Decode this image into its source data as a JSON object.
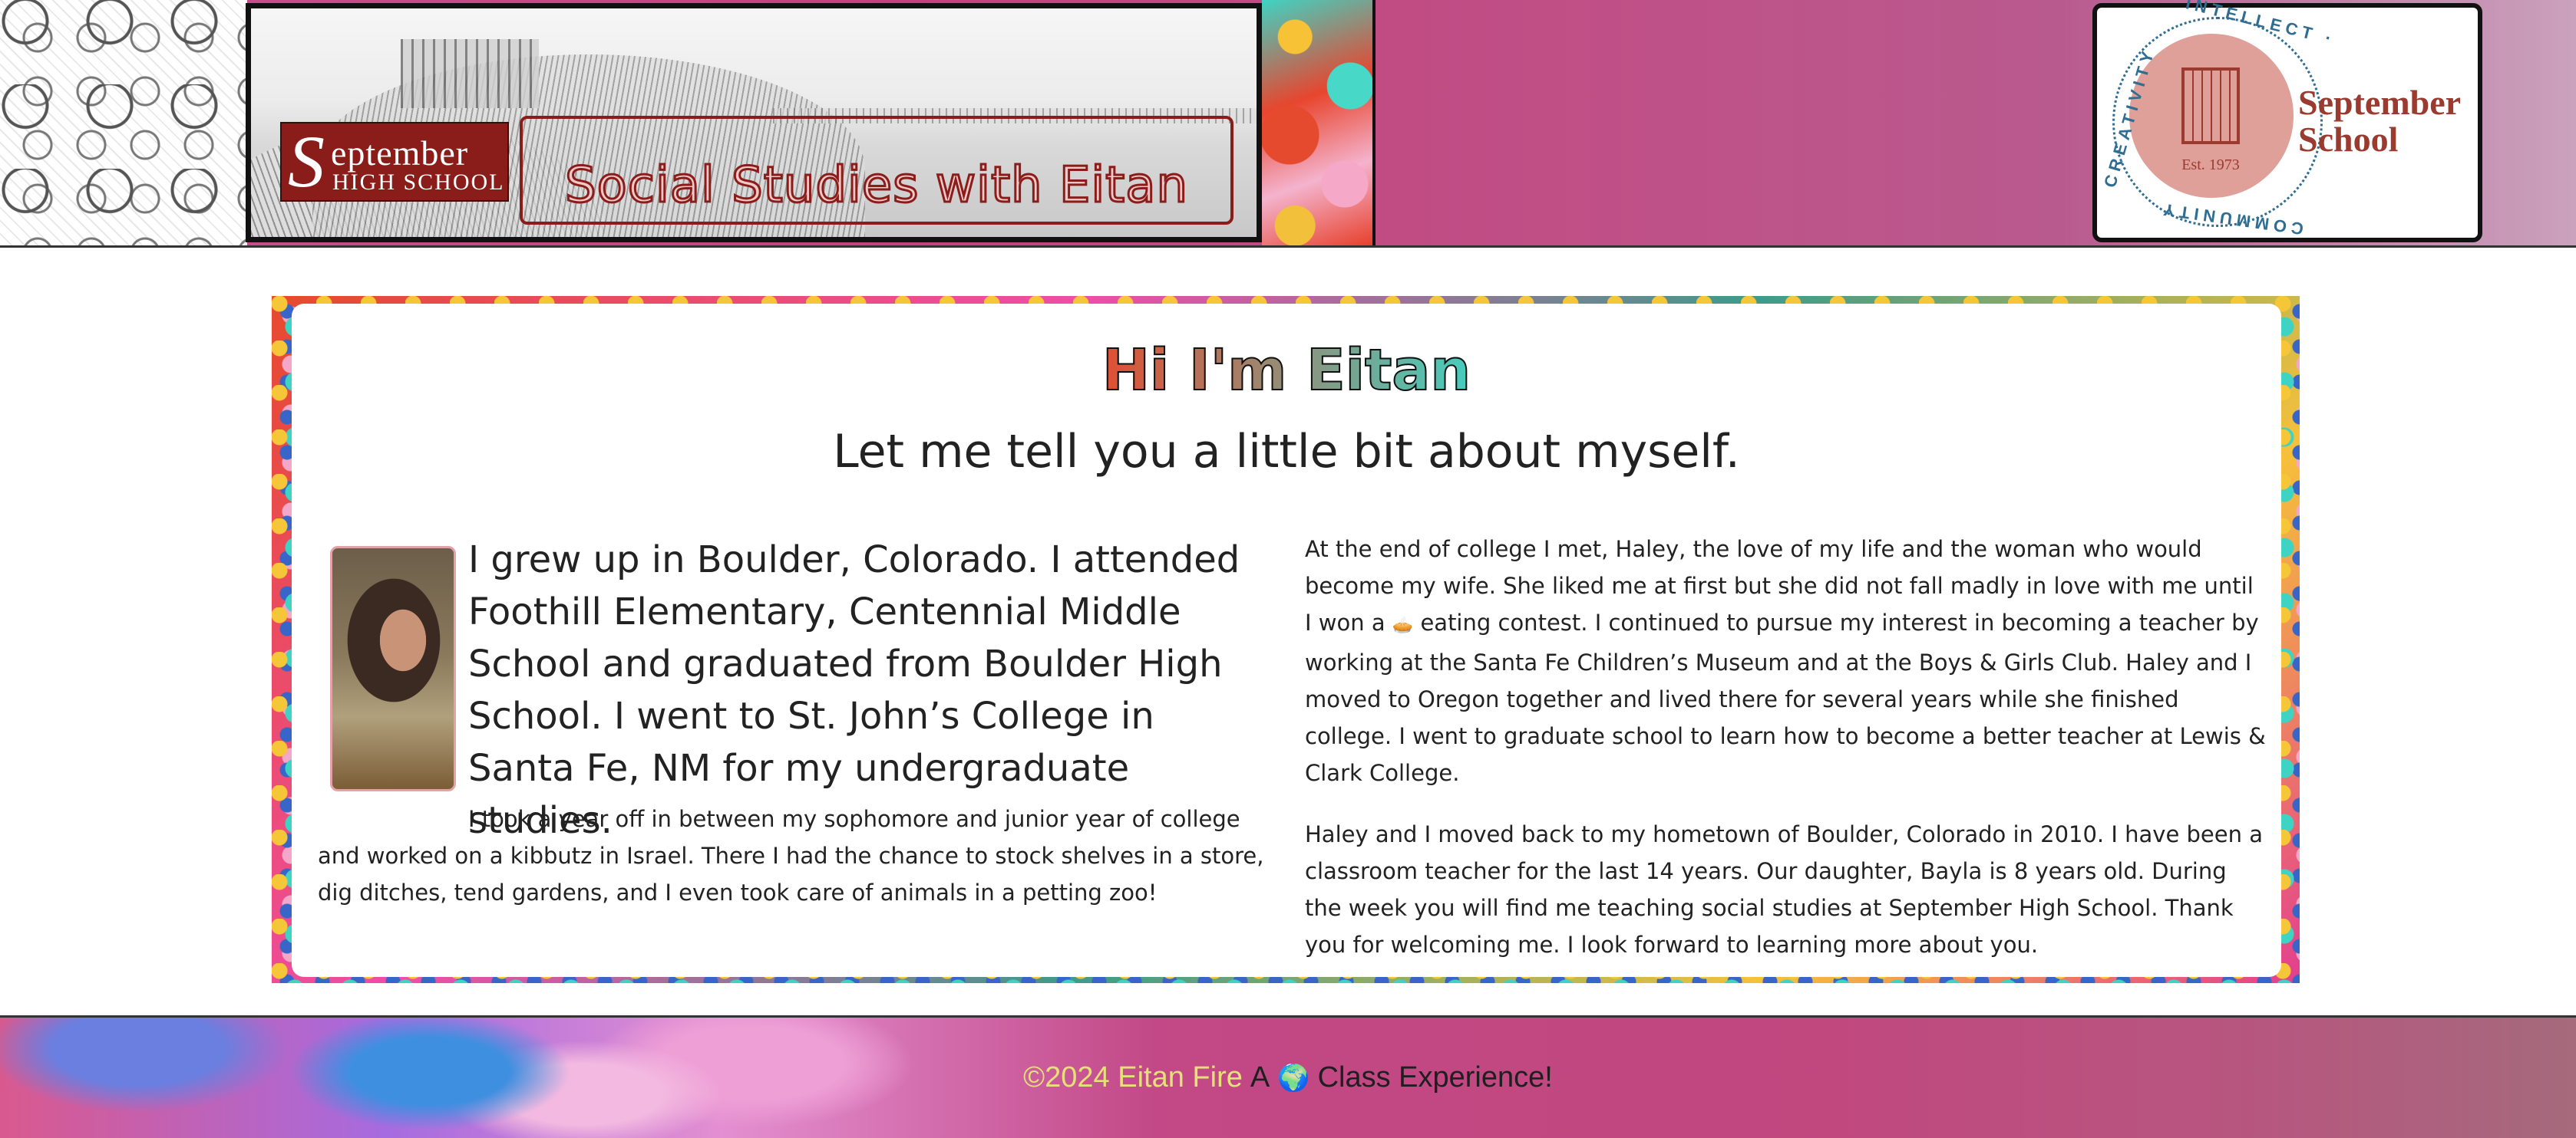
{
  "header": {
    "school_logo": {
      "initial": "S",
      "line1": "eptember",
      "line2": "HIGH SCHOOL"
    },
    "banner_title": "Social Studies with Eitan",
    "seal": {
      "top_text": "· INTELLECT ·",
      "left_text": "CREATIVITY",
      "bottom_text": "COMMUNITY",
      "established": "Est. 1973",
      "name_line1": "September",
      "name_line2": "School"
    }
  },
  "main": {
    "greeting": "Hi I'm Eitan",
    "subheading": "Let me tell you a little bit about myself.",
    "lead_paragraph": "I grew up in Boulder, Colorado. I attended Foothill Elementary, Centennial Middle School and graduated from Boulder High School. I went to St. John’s College in Santa Fe, NM for my undergraduate studies.",
    "kibbutz_paragraph": "I took a year off in between my sophomore and junior year of college and worked on a kibbutz in Israel. There I had the chance to stock shelves in a store, dig ditches, tend gardens, and I even took care of animals in a petting zoo!",
    "college_paragraph_before": "At the end of college I met, Haley, the love of my life and the woman who would become my wife. She liked me at first but she did not fall madly in love with me until I won a",
    "college_paragraph_emoji": "🥧",
    "college_paragraph_after": "eating contest. I continued to pursue my interest in becoming a teacher by working at the Santa Fe Children’s Museum and at the Boys & Girls Club. Haley and I moved to Oregon together and lived there for several years while she finished college. I went to graduate school to learn how to become a better teacher at Lewis & Clark College.",
    "boulder_paragraph": "Haley and I moved back to my hometown of Boulder, Colorado in 2010. I have been a classroom teacher for the last 14 years. Our daughter, Bayla is 8 years old. During the week you will find me teaching social studies at September High School. Thank you for welcoming me. I look forward to learning more about you."
  },
  "footer": {
    "copyright": "©2024 Eitan Fire",
    "prefix": "A",
    "emoji": "🌍",
    "suffix": "Class Experience!"
  },
  "colors": {
    "brand_red": "#8a1d1a",
    "header_pink": "#c4427f",
    "seal_blue": "#2f6d92",
    "copyright_yellow": "#e6e07a"
  }
}
